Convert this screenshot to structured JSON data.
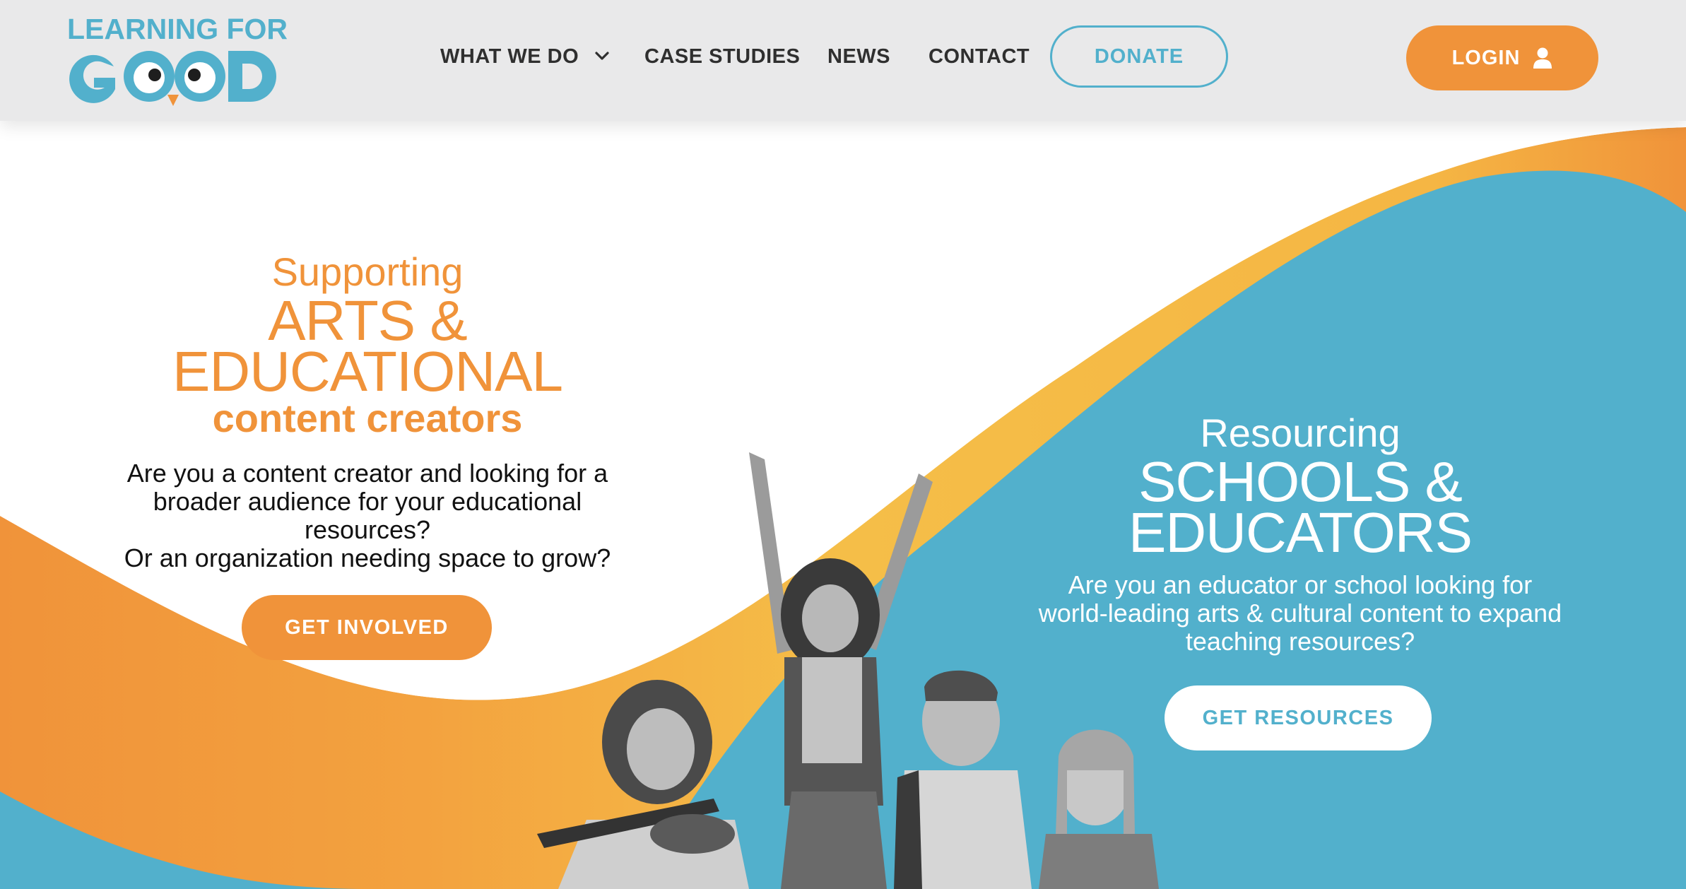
{
  "colors": {
    "brand_blue": "#52b0cc",
    "brand_orange": "#f0933a",
    "brand_yellow": "#f5be48",
    "header_bg": "#e9e9ea"
  },
  "header": {
    "logo_line1": "LEARNING FOR",
    "logo_line2": "GOOD",
    "nav": [
      {
        "label": "WHAT WE DO",
        "icon": "chevron-down-icon"
      },
      {
        "label": "CASE STUDIES"
      },
      {
        "label": "NEWS"
      },
      {
        "label": "CONTACT"
      }
    ],
    "donate_label": "DONATE",
    "login_label": "LOGIN",
    "login_icon": "user-icon"
  },
  "hero": {
    "left": {
      "sub1": "Supporting",
      "big1": "ARTS &",
      "big2": "EDUCATIONAL",
      "sub2": "content creators",
      "body_lines": [
        "Are you a content creator and looking for a",
        "broader audience for your educational",
        "resources?",
        "Or an organization needing space to grow?"
      ],
      "button_label": "GET INVOLVED"
    },
    "right": {
      "sub1": "Resourcing",
      "big1": "SCHOOLS &",
      "big2": "EDUCATORS",
      "body_lines": [
        "Are you an educator or school looking for",
        "world-leading arts & cultural content to expand",
        "teaching resources?"
      ],
      "button_label": "GET RESOURCES"
    }
  }
}
